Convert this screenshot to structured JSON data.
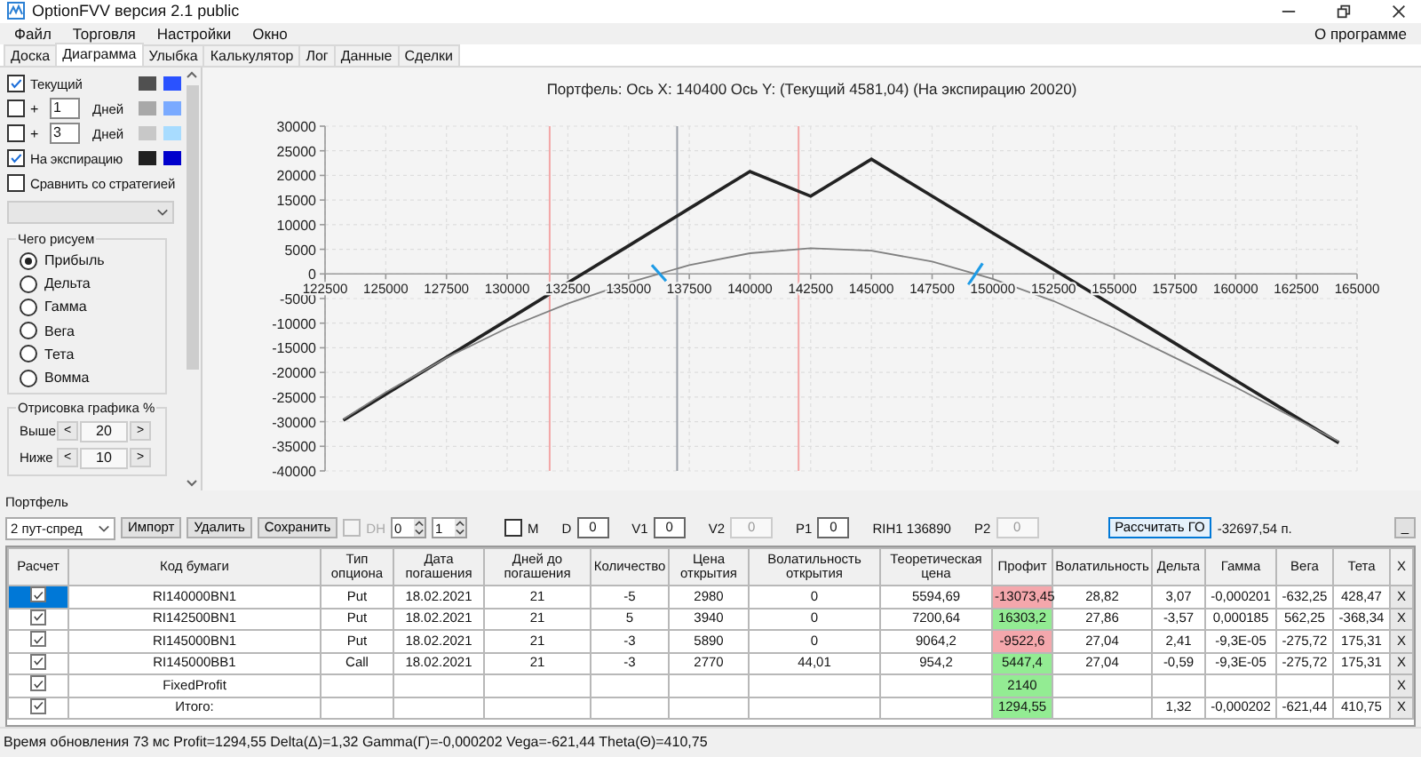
{
  "window": {
    "title": "OptionFVV версия 2.1 public"
  },
  "menu": {
    "items": [
      "Файл",
      "Торговля",
      "Настройки",
      "Окно"
    ],
    "right": "О программе"
  },
  "tabs": [
    {
      "label": "Доска",
      "selected": false
    },
    {
      "label": "Диаграмма",
      "selected": true
    },
    {
      "label": "Улыбка",
      "selected": false
    },
    {
      "label": "Калькулятор",
      "selected": false
    },
    {
      "label": "Лог",
      "selected": false
    },
    {
      "label": "Данные",
      "selected": false
    },
    {
      "label": "Сделки",
      "selected": false
    }
  ],
  "curves": [
    {
      "kind": "curve",
      "label": "Текущий",
      "checked": true,
      "swatches": [
        {
          "color": "#505050"
        },
        {
          "color": "#2a52ff"
        }
      ]
    },
    {
      "kind": "days",
      "prefix": "+",
      "days": "1",
      "label": "Дней",
      "checked": false,
      "swatches": [
        {
          "color": "#a8a8a8"
        },
        {
          "color": "#7aaaff"
        }
      ]
    },
    {
      "kind": "days",
      "prefix": "+",
      "days": "3",
      "label": "Дней",
      "checked": false,
      "swatches": [
        {
          "color": "#c8c8c8"
        },
        {
          "color": "#a8dcff"
        }
      ]
    },
    {
      "kind": "curve",
      "label": "На экспирацию",
      "checked": true,
      "swatches": [
        {
          "color": "#202020"
        },
        {
          "color": "#0000cc"
        }
      ]
    },
    {
      "kind": "plain",
      "label": "Сравнить со стратегией",
      "checked": false
    }
  ],
  "draw_group": {
    "title": "Чего рисуем",
    "options": [
      {
        "label": "Прибыль",
        "selected": true
      },
      {
        "label": "Дельта",
        "selected": false
      },
      {
        "label": "Гамма",
        "selected": false
      },
      {
        "label": "Вега",
        "selected": false
      },
      {
        "label": "Тета",
        "selected": false
      },
      {
        "label": "Вомма",
        "selected": false
      }
    ]
  },
  "range_group": {
    "title": "Отрисовка графика %",
    "rows": [
      {
        "label": "Выше",
        "dec": "<",
        "value": "20",
        "inc": ">"
      },
      {
        "label": "Ниже",
        "dec": "<",
        "value": "10",
        "inc": ">"
      }
    ]
  },
  "chart": {
    "title": "Портфель: Ось X: 140400 Ось Y:  (Текущий 4581,04)  (На экспирацию 20020)",
    "chart_data": {
      "type": "line",
      "grid": true,
      "x": [
        123250,
        125000,
        127500,
        130000,
        132500,
        135000,
        137500,
        140000,
        142500,
        145000,
        147500,
        150000,
        152500,
        155000,
        157500,
        160000,
        162500,
        164250
      ],
      "series": [
        {
          "color": "#222222",
          "values": [
            -29700,
            -24400,
            -16900,
            -9400,
            -1800,
            5700,
            13300,
            20800,
            15800,
            23300,
            15800,
            8300,
            900,
            -6600,
            -14100,
            -21600,
            -29100,
            -34300
          ]
        },
        {
          "color": "#808080",
          "values": [
            -29500,
            -24000,
            -17000,
            -11000,
            -6000,
            -1800,
            1800,
            4200,
            5200,
            4700,
            2500,
            -1000,
            -5500,
            -11000,
            -17000,
            -23000,
            -29500,
            -34000
          ]
        }
      ],
      "xlim": [
        122500,
        165000
      ],
      "ylim": [
        -40000,
        30000
      ],
      "xticks": [
        122500,
        125000,
        127500,
        130000,
        132500,
        135000,
        137500,
        140000,
        142500,
        145000,
        147500,
        150000,
        152500,
        155000,
        157500,
        160000,
        162500,
        165000
      ],
      "yticks": [
        -40000,
        -35000,
        -30000,
        -25000,
        -20000,
        -15000,
        -10000,
        -5000,
        0,
        5000,
        10000,
        15000,
        20000,
        25000,
        30000
      ],
      "ref_lines": [
        {
          "axis": "x",
          "value": 131750,
          "color": "#f3a6a6"
        },
        {
          "axis": "x",
          "value": 142000,
          "color": "#f3a6a6"
        },
        {
          "axis": "x",
          "value": 137000,
          "color": "#9aa0a8"
        }
      ]
    }
  },
  "portfolio": {
    "title": "Портфель",
    "strategy": "2 пут-спред",
    "buttons": [
      "Импорт",
      "Удалить",
      "Сохранить"
    ],
    "dh": {
      "label": "DH",
      "checked": false,
      "disabled": true
    },
    "spinners": [
      "0",
      "1"
    ],
    "m": {
      "label": "M",
      "checked": false
    },
    "fields": [
      {
        "kind": "field",
        "label": "D",
        "value": "0",
        "disabled": false
      },
      {
        "kind": "field",
        "label": "V1",
        "value": "0",
        "disabled": false
      },
      {
        "kind": "field",
        "label": "V2",
        "value": "0",
        "disabled": true
      },
      {
        "kind": "field",
        "label": "P1",
        "value": "0",
        "disabled": false
      },
      {
        "kind": "text",
        "label": "RIH1 136890"
      },
      {
        "kind": "field",
        "label": "P2",
        "value": "0",
        "disabled": true
      }
    ],
    "calc_button": "Рассчитать ГО",
    "margin": "-32697,54 п.",
    "more_button": "_"
  },
  "table": {
    "columns": [
      "Расчет",
      "Код бумаги",
      "Тип опциона",
      "Дата погашения",
      "Дней до погашения",
      "Количество",
      "Цена открытия",
      "Волатильность открытия",
      "Теоретическая цена",
      "Профит",
      "Волатильность",
      "Дельта",
      "Гамма",
      "Вега",
      "Тета",
      "X"
    ],
    "rows": [
      {
        "checked": true,
        "selected": true,
        "color": "#f4a7ac",
        "cells": [
          "",
          "RI140000BN1",
          "Put",
          "18.02.2021",
          "21",
          "-5",
          "2980",
          "0",
          "5594,69",
          "-13073,45",
          "28,82",
          "3,07",
          "-0,000201",
          "-632,25",
          "428,47",
          "X"
        ]
      },
      {
        "checked": true,
        "selected": false,
        "color": "#93ec93",
        "cells": [
          "",
          "RI142500BN1",
          "Put",
          "18.02.2021",
          "21",
          "5",
          "3940",
          "0",
          "7200,64",
          "16303,2",
          "27,86",
          "-3,57",
          "0,000185",
          "562,25",
          "-368,34",
          "X"
        ]
      },
      {
        "checked": true,
        "selected": false,
        "color": "#f4a7ac",
        "cells": [
          "",
          "RI145000BN1",
          "Put",
          "18.02.2021",
          "21",
          "-3",
          "5890",
          "0",
          "9064,2",
          "-9522,6",
          "27,04",
          "2,41",
          "-9,3E-05",
          "-275,72",
          "175,31",
          "X"
        ]
      },
      {
        "checked": true,
        "selected": false,
        "color": "#93ec93",
        "cells": [
          "",
          "RI145000BB1",
          "Call",
          "18.02.2021",
          "21",
          "-3",
          "2770",
          "44,01",
          "954,2",
          "5447,4",
          "27,04",
          "-0,59",
          "-9,3E-05",
          "-275,72",
          "175,31",
          "X"
        ]
      },
      {
        "checked": true,
        "selected": false,
        "color": "#93ec93",
        "cells": [
          "",
          "FixedProfit",
          "",
          "",
          "",
          "",
          "",
          "",
          "",
          "2140",
          "",
          "",
          "",
          "",
          "",
          "X"
        ]
      },
      {
        "checked": true,
        "selected": false,
        "color": "#93ec93",
        "cells": [
          "",
          "Итого:",
          "",
          "",
          "",
          "",
          "",
          "",
          "",
          "1294,55",
          "",
          "1,32",
          "-0,000202",
          "-621,44",
          "410,75",
          "X"
        ]
      }
    ]
  },
  "status_bar": "Время обновления 73 мс  Profit=1294,55 Delta(Δ)=1,32 Gamma(Г)=-0,000202 Vega=-621,44 Theta(Θ)=410,75"
}
